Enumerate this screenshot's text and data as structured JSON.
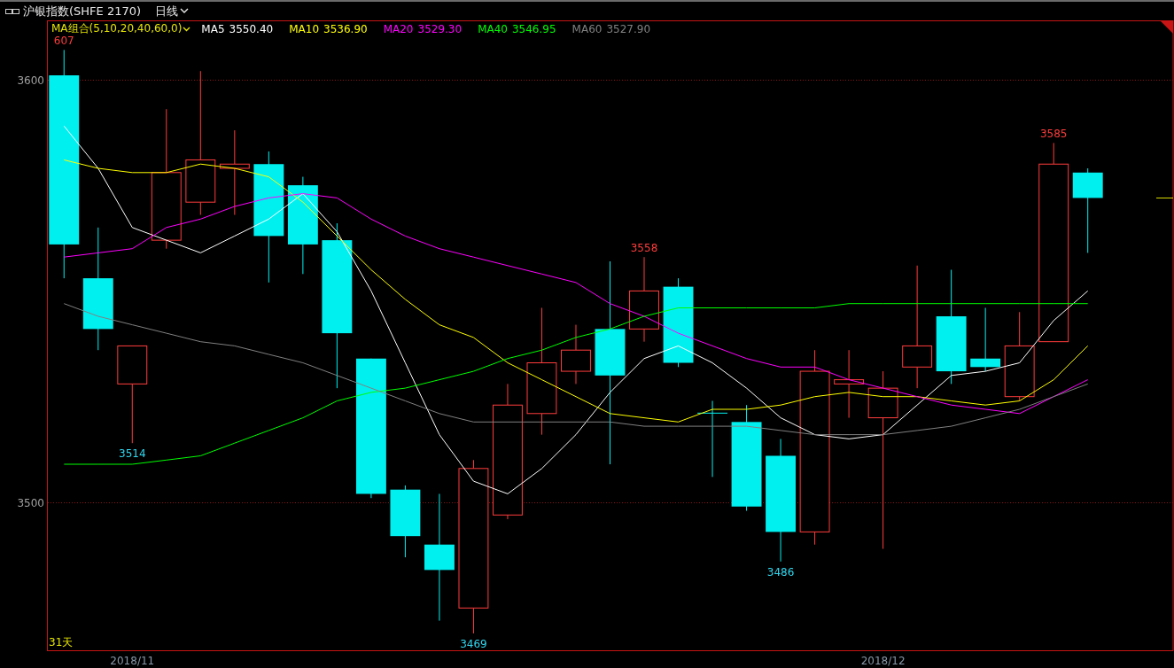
{
  "header": {
    "title": "沪银指数(SHFE 2170)",
    "period": "日线"
  },
  "ma_selector": "MA组合(5,10,20,40,60,0)",
  "ma_legend": [
    {
      "value": "3550.40"
    },
    {
      "value": "3536.90"
    },
    {
      "value": "3529.30"
    },
    {
      "value": "3546.95"
    },
    {
      "value": "3527.90"
    }
  ],
  "day_count": "31天",
  "chart_data": {
    "type": "candlestick",
    "ylim": [
      3465,
      3614
    ],
    "yticks": [
      3500,
      3600
    ],
    "categories": [
      null,
      null,
      "2018/11",
      null,
      null,
      null,
      null,
      null,
      null,
      null,
      null,
      null,
      null,
      null,
      null,
      null,
      null,
      null,
      null,
      null,
      null,
      null,
      null,
      null,
      "2018/12",
      null,
      null,
      null,
      null,
      null,
      null,
      null,
      null
    ],
    "series": [
      {
        "type": "line",
        "name": "MA5",
        "color": "#ffffff",
        "values": [
          3589,
          3579,
          3565,
          3562,
          3559,
          3563,
          3567,
          3573,
          3564,
          3550,
          3533,
          3516,
          3505,
          3502,
          3508,
          3516,
          3526,
          3534,
          3537,
          3533,
          3527,
          3520,
          3516,
          3515,
          3516,
          3523,
          3530,
          3531,
          3533,
          3543,
          3550,
          null,
          null
        ]
      },
      {
        "type": "line",
        "name": "MA10",
        "color": "#ffff00",
        "values": [
          3581,
          3579,
          3578,
          3578,
          3580,
          3579,
          3577,
          3571,
          3563,
          3555,
          3548,
          3542,
          3539,
          3533,
          3529,
          3525,
          3521,
          3520,
          3519,
          3522,
          3522,
          3523,
          3525,
          3526,
          3525,
          3525,
          3524,
          3523,
          3524,
          3529,
          3537,
          null,
          null
        ]
      },
      {
        "type": "line",
        "name": "MA20",
        "color": "#ff00ff",
        "values": [
          3558,
          3559,
          3560,
          3565,
          3567,
          3570,
          3572,
          3573,
          3572,
          3567,
          3563,
          3560,
          3558,
          3556,
          3554,
          3552,
          3547,
          3544,
          3540,
          3537,
          3534,
          3532,
          3532,
          3529,
          3527,
          3525,
          3523,
          3522,
          3521,
          3525,
          3529,
          null,
          null
        ]
      },
      {
        "type": "line",
        "name": "MA40",
        "color": "#00ff00",
        "values": [
          3509,
          3509,
          3509,
          3510,
          3511,
          3514,
          3517,
          3520,
          3524,
          3526,
          3527,
          3529,
          3531,
          3534,
          3536,
          3539,
          3541,
          3544,
          3546,
          3546,
          3546,
          3546,
          3546,
          3547,
          3547,
          3547,
          3547,
          3547,
          3547,
          3547,
          3547,
          null,
          null
        ]
      },
      {
        "type": "line",
        "name": "MA60",
        "color": "#808080",
        "values": [
          3547,
          3544,
          3542,
          3540,
          3538,
          3537,
          3535,
          3533,
          3530,
          3527,
          3524,
          3521,
          3519,
          3519,
          3519,
          3519,
          3519,
          3518,
          3518,
          3518,
          3518,
          3517,
          3516,
          3516,
          3516,
          3517,
          3518,
          3520,
          3522,
          3525,
          3528,
          null,
          null
        ]
      },
      {
        "ohlc": [
          [
            3601,
            3607,
            3553,
            3561
          ],
          [
            3553,
            3565,
            3536,
            3541
          ],
          [
            3528,
            3537,
            3514,
            3537
          ],
          [
            3562,
            3593,
            3560,
            3578
          ],
          [
            3571,
            3602,
            3568,
            3581
          ],
          [
            3579,
            3588,
            3568,
            3580
          ],
          [
            3580,
            3583,
            3552,
            3563
          ],
          [
            3575,
            3577,
            3554,
            3561
          ],
          [
            3562,
            3566,
            3527,
            3540
          ],
          [
            3534,
            3534,
            3501,
            3502
          ],
          [
            3503,
            3504,
            3487,
            3492
          ],
          [
            3490,
            3502,
            3472,
            3484
          ],
          [
            3475,
            3510,
            3469,
            3508
          ],
          [
            3497,
            3528,
            3496,
            3523
          ],
          [
            3521,
            3546,
            3516,
            3533
          ],
          [
            3531,
            3542,
            3528,
            3536
          ],
          [
            3541,
            3557,
            3509,
            3530
          ],
          [
            3541,
            3558,
            3538,
            3550
          ],
          [
            3551,
            3553,
            3532,
            3533
          ],
          [
            3521.2,
            3524,
            3506,
            3521
          ],
          [
            3519,
            3523,
            3498,
            3499
          ],
          [
            3511,
            3515,
            3486,
            3493
          ],
          [
            3493,
            3536,
            3490,
            3531
          ],
          [
            3528,
            3536,
            3520,
            3529
          ],
          [
            3520,
            3531,
            3489,
            3527
          ],
          [
            3532,
            3556,
            3527,
            3537
          ],
          [
            3544,
            3555,
            3528,
            3531
          ],
          [
            3534,
            3546,
            3531,
            3532
          ],
          [
            3525,
            3545,
            3524,
            3537
          ],
          [
            3538,
            3585,
            3538,
            3580
          ],
          [
            3578,
            3579,
            3559,
            3572
          ],
          null,
          null
        ]
      }
    ],
    "annotations": [
      "607",
      "3514",
      "3469",
      "3558",
      "3486",
      "3585"
    ]
  }
}
